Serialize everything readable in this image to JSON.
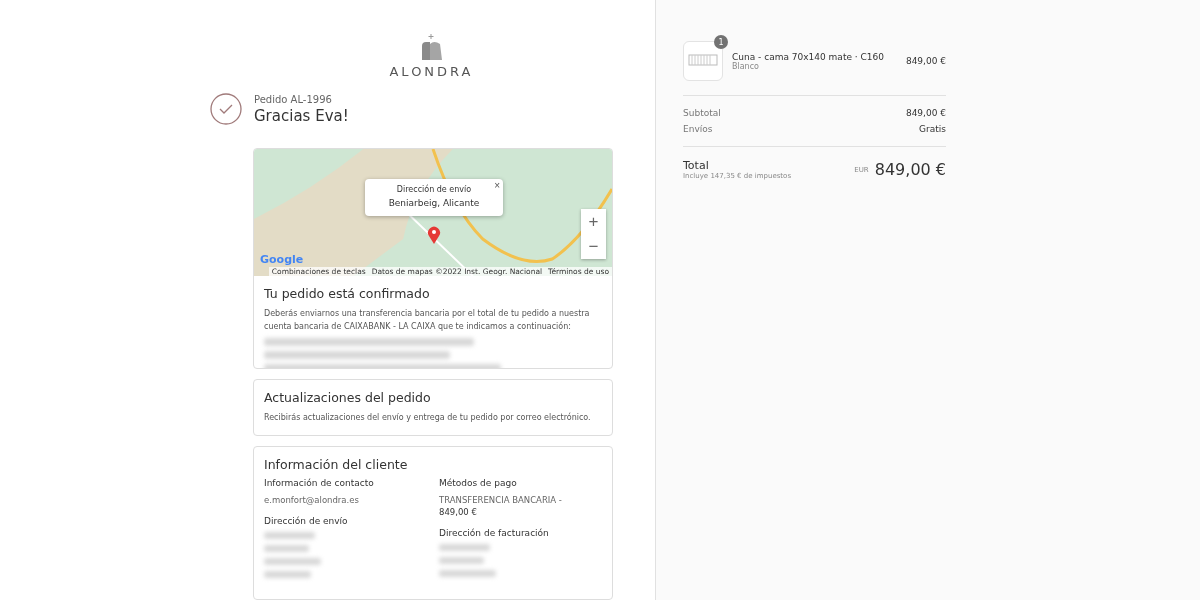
{
  "brand": {
    "name": "ALONDRA"
  },
  "order": {
    "number": "Pedido AL-1996",
    "greeting": "Gracias Eva!"
  },
  "map": {
    "popup": {
      "title": "Dirección de envío",
      "address": "Beniarbeig, Alicante",
      "close": "×"
    },
    "zoom_in": "+",
    "zoom_out": "−",
    "logo": "Google",
    "attribution": [
      "Combinaciones de teclas",
      "Datos de mapas ©2022 Inst. Geogr. Nacional",
      "Términos de uso"
    ]
  },
  "confirmation": {
    "title": "Tu pedido está confirmado",
    "text": "Deberás enviarnos una transferencia bancaria por el total de tu pedido a nuestra cuenta bancaria de CAIXABANK - LA CAIXA que te indicamos a continuación:"
  },
  "updates": {
    "title": "Actualizaciones del pedido",
    "text": "Recibirás actualizaciones del envío y entrega de tu pedido por correo electrónico."
  },
  "customer": {
    "title": "Información del cliente",
    "left": [
      {
        "heading": "Información de contacto",
        "lines": [
          "e.monfort@alondra.es"
        ]
      },
      {
        "heading": "Dirección de envío"
      }
    ],
    "right": [
      {
        "heading": "Métodos de pago",
        "lines": [
          "TRANSFERENCIA BANCARIA - ",
          "849,00 €"
        ]
      },
      {
        "heading": "Dirección de facturación"
      }
    ]
  },
  "cart": {
    "items": [
      {
        "name": "Cuna - cama 70x140 mate · C160",
        "variant": "Blanco",
        "price": "849,00 €",
        "quantity": "1"
      }
    ],
    "subtotal_label": "Subtotal",
    "subtotal": "849,00 €",
    "shipping_label": "Envíos",
    "shipping": "Gratis",
    "total_label": "Total",
    "tax_note": "Incluye 147,35 € de impuestos",
    "currency": "EUR",
    "total": "849,00 €"
  }
}
